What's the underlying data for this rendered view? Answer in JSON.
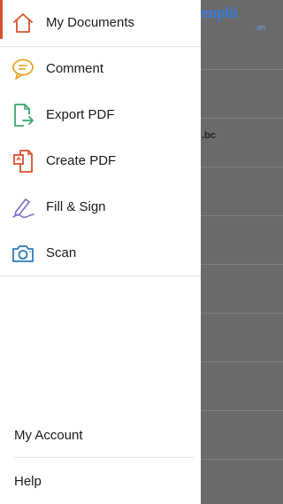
{
  "background": {
    "filename_fragment": ".bc",
    "watermark": "Taimienphi",
    "watermark_sub": ".vn"
  },
  "menu": {
    "items": [
      {
        "label": "My Documents",
        "icon": "home-icon",
        "active": true,
        "color": "#d9502f"
      },
      {
        "label": "Comment",
        "icon": "comment-icon",
        "color": "#e8a72b"
      },
      {
        "label": "Export PDF",
        "icon": "export-pdf-icon",
        "color": "#3aa56a"
      },
      {
        "label": "Create PDF",
        "icon": "create-pdf-icon",
        "color": "#d9502f"
      },
      {
        "label": "Fill & Sign",
        "icon": "fill-sign-icon",
        "color": "#7a6cc9"
      },
      {
        "label": "Scan",
        "icon": "camera-icon",
        "color": "#2b7bb9"
      }
    ]
  },
  "footer": {
    "my_account": "My Account",
    "help": "Help"
  },
  "colors": {
    "accent": "#d9502f",
    "overlay": "#6b6b6b"
  }
}
